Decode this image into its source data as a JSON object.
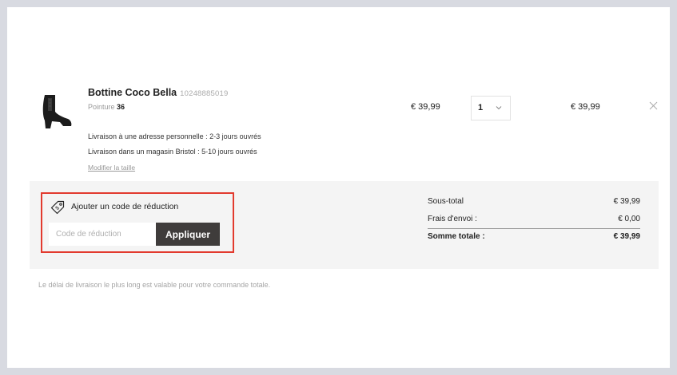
{
  "product": {
    "name": "Bottine Coco Bella",
    "sku": "10248885019",
    "size_label": "Pointure",
    "size_value": "36",
    "unit_price": "€ 39,99",
    "quantity": "1",
    "line_total": "€ 39,99",
    "image_icon": "ankle-boot-icon",
    "remove_icon": "close-icon"
  },
  "delivery": {
    "home": "Livraison à une adresse personnelle : 2-3 jours ouvrés",
    "store": "Livraison dans un magasin Bristol : 5-10 jours ouvrés",
    "modify_size": "Modifier la taille"
  },
  "discount": {
    "title": "Ajouter un code de réduction",
    "placeholder": "Code de réduction",
    "value": "",
    "apply_label": "Appliquer",
    "icon": "tag-icon",
    "highlight_color": "#e23a2e"
  },
  "summary": {
    "subtotal_label": "Sous-total",
    "subtotal_value": "€ 39,99",
    "shipping_label": "Frais d'envoi :",
    "shipping_value": "€ 0,00",
    "total_label": "Somme totale :",
    "total_value": "€ 39,99"
  },
  "note": "Le délai de livraison le plus long est valable pour votre commande totale.",
  "colors": {
    "background": "#d8dae1",
    "panel": "#f4f4f4",
    "button": "#3f3c3b"
  }
}
